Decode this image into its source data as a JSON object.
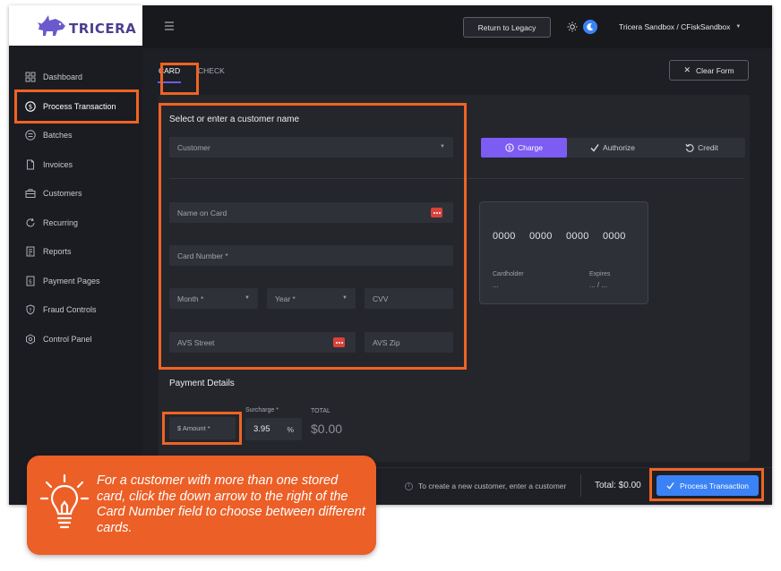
{
  "brand": {
    "logo_text": "TRICERA"
  },
  "sidebar": {
    "items": [
      {
        "label": "Dashboard",
        "icon": "grid-icon"
      },
      {
        "label": "Process Transaction",
        "icon": "dollar-circle-icon"
      },
      {
        "label": "Batches",
        "icon": "batches-icon"
      },
      {
        "label": "Invoices",
        "icon": "invoice-icon"
      },
      {
        "label": "Customers",
        "icon": "briefcase-icon"
      },
      {
        "label": "Recurring",
        "icon": "refresh-icon"
      },
      {
        "label": "Reports",
        "icon": "report-icon"
      },
      {
        "label": "Payment Pages",
        "icon": "dollar-page-icon"
      },
      {
        "label": "Fraud Controls",
        "icon": "shield-icon"
      },
      {
        "label": "Control Panel",
        "icon": "hexagon-gear-icon"
      }
    ],
    "active_index": 1
  },
  "header": {
    "legacy_button": "Return to Legacy",
    "account": "Tricera Sandbox / CFiskSandbox"
  },
  "tabs": {
    "card": "CARD",
    "check": "CHECK"
  },
  "clear_form": "Clear Form",
  "customer": {
    "title": "Select or enter a customer name",
    "placeholder": "Customer"
  },
  "modes": {
    "charge": "Charge",
    "authorize": "Authorize",
    "credit": "Credit"
  },
  "card_fields": {
    "name_on_card": "Name on Card",
    "card_number": "Card Number *",
    "month": "Month *",
    "year": "Year *",
    "cvv": "CVV",
    "avs_street": "AVS Street",
    "avs_zip": "AVS Zip"
  },
  "card_preview": {
    "groups": [
      "0000",
      "0000",
      "0000",
      "0000"
    ],
    "cardholder_label": "Cardholder",
    "cardholder_value": "...",
    "expires_label": "Expires",
    "expires_value": "... / ..."
  },
  "payment": {
    "title": "Payment Details",
    "amount_placeholder": "$ Amount *",
    "surcharge_label": "Surcharge *",
    "surcharge_value": "3.95",
    "surcharge_unit": "%",
    "total_label": "TOTAL",
    "total_value": "$0.00"
  },
  "footer": {
    "hint": "To create a new customer, enter a customer",
    "total": "Total: $0.00",
    "process_button": "Process Transaction"
  },
  "tip": {
    "text": "For a customer with more than one stored card, click the down arrow to the right of the Card Number field to choose between different cards."
  },
  "colors": {
    "accent_purple": "#7c5cf2",
    "primary_blue": "#3b82f6",
    "highlight_orange": "#f06323",
    "tip_orange": "#ec5f27"
  }
}
